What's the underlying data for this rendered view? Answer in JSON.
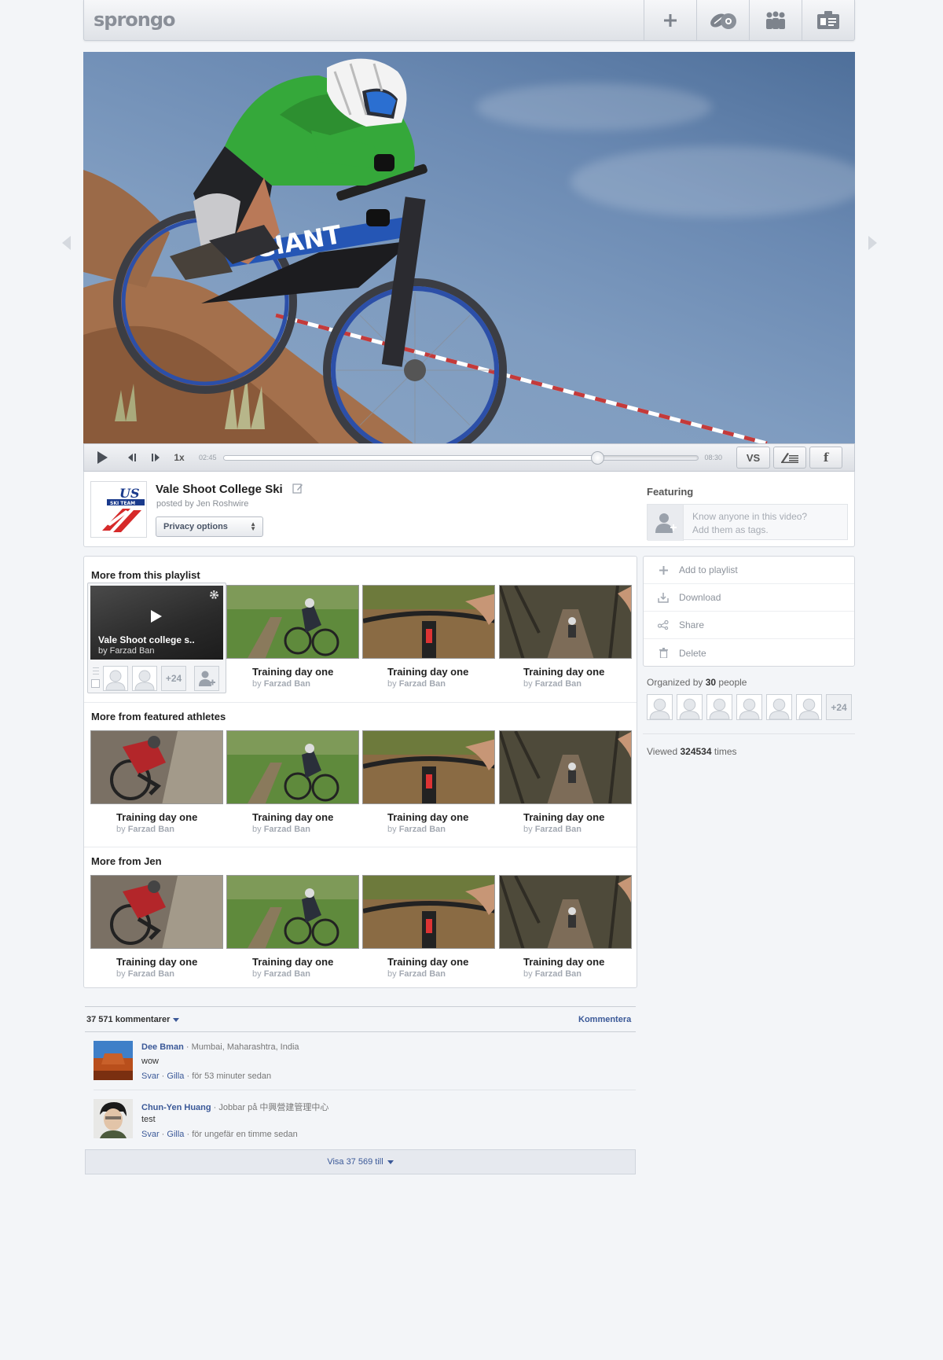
{
  "header": {
    "logo": "sprongo",
    "nav": [
      {
        "icon": "plus-icon"
      },
      {
        "icon": "sports-balls-icon"
      },
      {
        "icon": "team-icon"
      },
      {
        "icon": "id-card-icon"
      }
    ]
  },
  "player": {
    "speed": "1x",
    "current_time": "02:45",
    "duration": "08:30",
    "progress": 0.79,
    "vs_label": "VS",
    "facebook_label": "f"
  },
  "video_info": {
    "title": "Vale Shoot College Ski",
    "posted_by": "posted by Jen Roshwire",
    "privacy_label": "Privacy options",
    "team_logo_text": "US SKI TEAM",
    "featuring_label": "Featuring",
    "tag_prompt_line1": "Know anyone in this video?",
    "tag_prompt_line2": "Add them as tags."
  },
  "playlist": {
    "title": "More from this playlist",
    "current": {
      "title": "Vale Shoot college s..",
      "by": "by Farzad Ban",
      "extra_count": "+24"
    },
    "items": [
      {
        "title": "Training day one",
        "by_prefix": "by",
        "author": "Farzad Ban"
      },
      {
        "title": "Training day one",
        "by_prefix": "by",
        "author": "Farzad Ban"
      },
      {
        "title": "Training day one",
        "by_prefix": "by",
        "author": "Farzad Ban"
      }
    ]
  },
  "athletes": {
    "title": "More from featured athletes",
    "items": [
      {
        "title": "Training day one",
        "by_prefix": "by",
        "author": "Farzad Ban"
      },
      {
        "title": "Training day one",
        "by_prefix": "by",
        "author": "Farzad Ban"
      },
      {
        "title": "Training day one",
        "by_prefix": "by",
        "author": "Farzad Ban"
      },
      {
        "title": "Training day one",
        "by_prefix": "by",
        "author": "Farzad Ban"
      }
    ]
  },
  "jen": {
    "title": "More from Jen",
    "items": [
      {
        "title": "Training day one",
        "by_prefix": "by",
        "author": "Farzad Ban"
      },
      {
        "title": "Training day one",
        "by_prefix": "by",
        "author": "Farzad Ban"
      },
      {
        "title": "Training day one",
        "by_prefix": "by",
        "author": "Farzad Ban"
      },
      {
        "title": "Training day one",
        "by_prefix": "by",
        "author": "Farzad Ban"
      }
    ]
  },
  "actions": [
    {
      "label": "Add to playlist",
      "icon": "plus-icon"
    },
    {
      "label": "Download",
      "icon": "download-icon"
    },
    {
      "label": "Share",
      "icon": "share-icon"
    },
    {
      "label": "Delete",
      "icon": "trash-icon"
    }
  ],
  "organized": {
    "prefix": "Organized by",
    "count": "30",
    "suffix": "people",
    "extra": "+24"
  },
  "viewed": {
    "prefix": "Viewed",
    "count": "324534",
    "suffix": "times"
  },
  "comments": {
    "count_label": "37 571 kommentarer",
    "comment_action": "Kommentera",
    "items": [
      {
        "name": "Dee Bman",
        "detail": "· Mumbai, Maharashtra, India",
        "text": "wow",
        "reply": "Svar",
        "like": "Gilla",
        "time": "· för 53 minuter sedan"
      },
      {
        "name": "Chun-Yen Huang",
        "detail": "· Jobbar på 中興營建管理中心",
        "text": "test",
        "reply": "Svar",
        "like": "Gilla",
        "time": "· för ungefär en timme sedan"
      }
    ],
    "show_more": "Visa 37 569 till"
  },
  "colors": {
    "link": "#3b5998",
    "accent_green": "#3a9a2e",
    "page_bg": "#f3f5f8"
  }
}
